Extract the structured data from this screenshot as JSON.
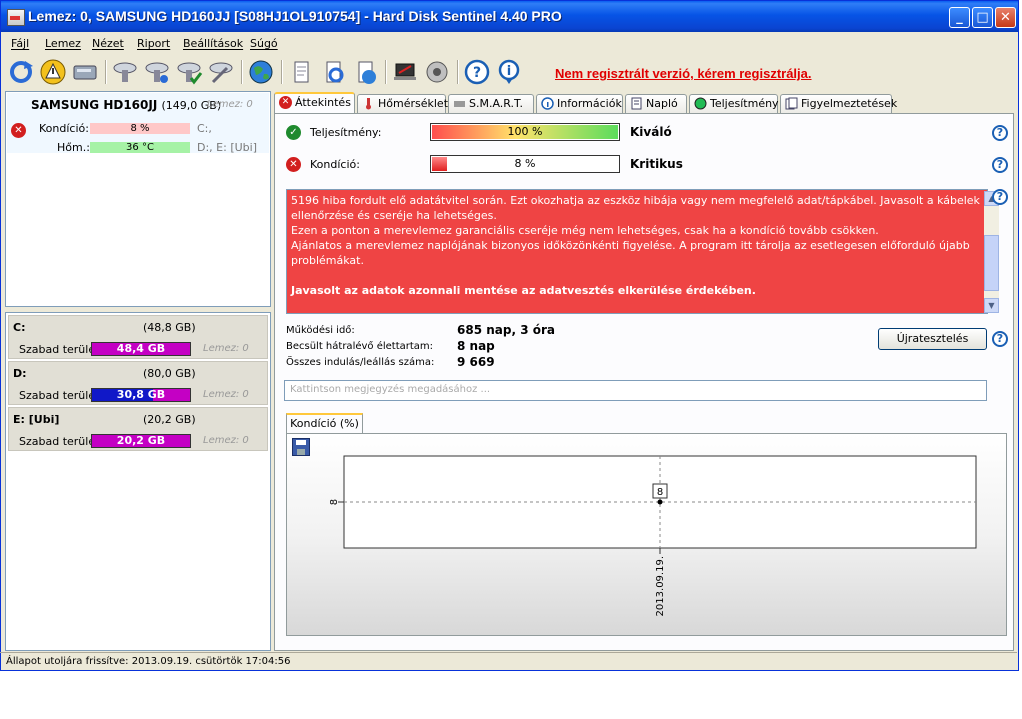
{
  "window": {
    "title": "Lemez: 0, SAMSUNG HD160JJ [S08HJ1OL910754]  -  Hard Disk Sentinel 4.40 PRO",
    "min": "_",
    "max": "□",
    "close": "✕"
  },
  "menu": [
    "Fájl",
    "Lemez",
    "Nézet",
    "Riport",
    "Beállítások",
    "Súgó"
  ],
  "registration_link": "Nem regisztrált verzió, kérem regisztrálja.",
  "disk": {
    "name": "SAMSUNG HD160JJ",
    "size": "(149,0 GB)",
    "tag": "Lemez: 0",
    "condition_label": "Kondíció:",
    "condition_value": "8 %",
    "condition_fraction": 0.08,
    "condition_drives": "C:,",
    "temp_label": "Hőm.:",
    "temp_value": "36 °C",
    "temp_drives": "D:, E: [Ubi]"
  },
  "volumes": [
    {
      "name": "C:",
      "size": "(48,8 GB)",
      "free_label": "Szabad terület",
      "free": "48,4 GB",
      "tag": "Lemez: 0",
      "color": "#c400c4"
    },
    {
      "name": "D:",
      "size": "(80,0 GB)",
      "free_label": "Szabad terület",
      "free": "30,8 GB",
      "tag": "Lemez: 0",
      "color": "#1018c8"
    },
    {
      "name": "E: [Ubi]",
      "size": "(20,2 GB)",
      "free_label": "Szabad terület",
      "free": "20,2 GB",
      "tag": "Lemez: 0",
      "color": "#c400c4"
    }
  ],
  "tabs": [
    "Áttekintés",
    "Hőmérséklet",
    "S.M.A.R.T.",
    "Információk",
    "Napló",
    "Teljesítmény",
    "Figyelmeztetések"
  ],
  "overview": {
    "performance_label": "Teljesítmény:",
    "performance_value": "100 %",
    "performance_fraction": 1.0,
    "performance_status": "Kiváló",
    "condition_label": "Kondíció:",
    "condition_value": "8 %",
    "condition_fraction": 0.08,
    "condition_status": "Kritikus",
    "message": {
      "line1": "5196 hiba fordult elő adatátvitel során. Ezt okozhatja az eszköz hibája vagy nem megfelelő adat/tápkábel. Javasolt a kábelek ellenőrzése és cseréje ha lehetséges.",
      "line2": "Ezen a ponton a merevlemez garanciális cseréje még nem lehetséges, csak ha a kondíció tovább csökken.",
      "line3": "Ajánlatos a merevlemez naplójának bizonyos időközönkénti figyelése. A program itt tárolja az esetlegesen előforduló újabb problémákat.",
      "line4": "Javasolt az adatok azonnali mentése az adatvesztés elkerülése érdekében."
    },
    "uptime_label": "Működési idő:",
    "uptime_value": "685 nap, 3 óra",
    "lifetime_label": "Becsült hátralévő élettartam:",
    "lifetime_value": "8 nap",
    "starts_label": "Összes indulás/leállás száma:",
    "starts_value": "9 669",
    "retest_button": "Újratesztelés",
    "note_placeholder": "Kattintson megjegyzés megadásához ...",
    "graph_tab": "Kondíció  (%)"
  },
  "chart_data": {
    "type": "line",
    "title": "",
    "xlabel": "",
    "ylabel": "",
    "x": [
      "2013.09.19."
    ],
    "series": [
      {
        "values": [
          8
        ]
      }
    ],
    "y_tick_labels": [
      "8"
    ],
    "data_labels": [
      "8"
    ],
    "grid": true
  },
  "statusbar": {
    "text": "Állapot utoljára frissítve: 2013.09.19. csütörtök 17:04:56"
  }
}
